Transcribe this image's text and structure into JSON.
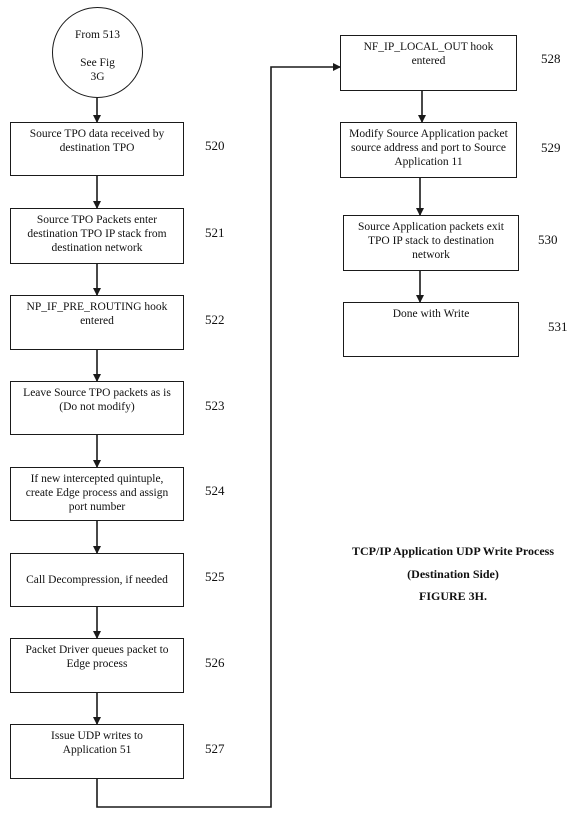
{
  "figure": {
    "title": "TCP/IP Application UDP Write Process",
    "subtitle": "(Destination Side)",
    "label": "FIGURE 3H."
  },
  "start": {
    "line1": "From 513",
    "line2": "See Fig",
    "line3": "3G"
  },
  "steps": [
    {
      "ref": "520",
      "text": "Source TPO data received by destination TPO"
    },
    {
      "ref": "521",
      "text": "Source TPO Packets enter destination TPO IP stack from destination network"
    },
    {
      "ref": "522",
      "text": "NP_IF_PRE_ROUTING hook entered"
    },
    {
      "ref": "523",
      "text": "Leave Source TPO packets as is (Do not modify)"
    },
    {
      "ref": "524",
      "text": "If new intercepted quintuple, create Edge process and assign port number"
    },
    {
      "ref": "525",
      "text": "Call Decompression, if needed"
    },
    {
      "ref": "526",
      "text": "Packet Driver queues packet to Edge process"
    },
    {
      "ref": "527",
      "text": "Issue UDP writes to Application 51"
    },
    {
      "ref": "528",
      "text": "NF_IP_LOCAL_OUT hook entered"
    },
    {
      "ref": "529",
      "text": "Modify Source Application packet source address and port to Source Application 11"
    },
    {
      "ref": "530",
      "text": "Source Application packets exit TPO IP stack to destination network"
    },
    {
      "ref": "531",
      "text": "Done with Write"
    }
  ],
  "flow": [
    [
      "start",
      "520"
    ],
    [
      "520",
      "521"
    ],
    [
      "521",
      "522"
    ],
    [
      "522",
      "523"
    ],
    [
      "523",
      "524"
    ],
    [
      "524",
      "525"
    ],
    [
      "525",
      "526"
    ],
    [
      "526",
      "527"
    ],
    [
      "527",
      "528"
    ],
    [
      "528",
      "529"
    ],
    [
      "529",
      "530"
    ],
    [
      "530",
      "531"
    ]
  ]
}
